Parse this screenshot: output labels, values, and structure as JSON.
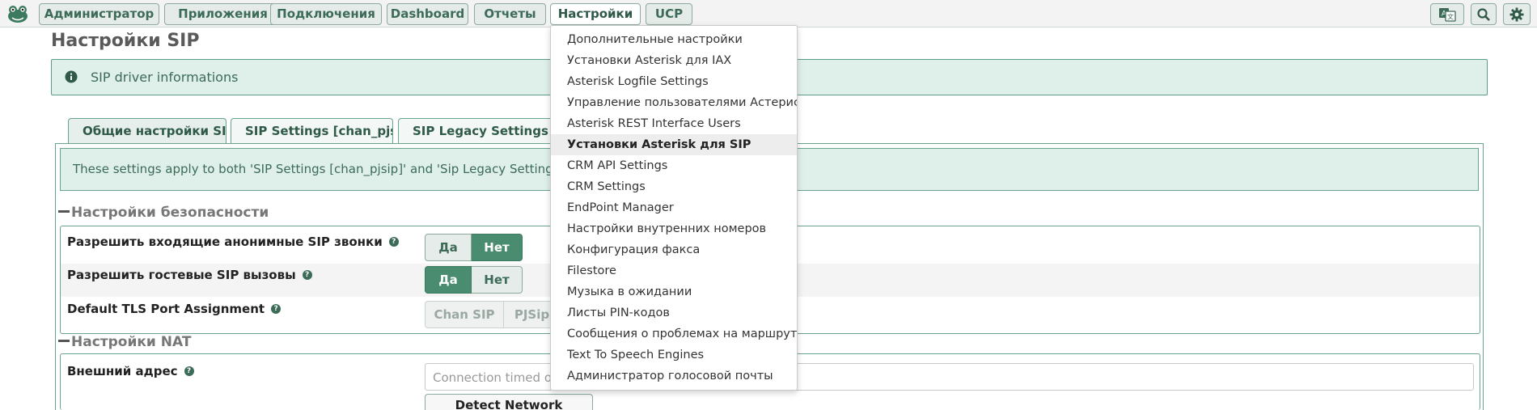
{
  "nav": {
    "items": [
      "Администратор",
      "Приложения",
      "Подключения",
      "Dashboard",
      "Отчеты",
      "Настройки",
      "UCP"
    ]
  },
  "icons": {
    "logo": "frog-logo-icon",
    "translate": "translate-icon",
    "search": "search-icon",
    "settings": "gear-icon",
    "info": "info-icon",
    "help": "question-icon"
  },
  "colors": {
    "accent": "#4a8c6f",
    "alert_bg": "#dfefea",
    "border": "#6aa38b"
  },
  "page": {
    "title": "Настройки SIP"
  },
  "alert": {
    "text": "SIP driver informations"
  },
  "tabs": [
    "Общие настройки SIP",
    "SIP Settings [chan_pjsip]",
    "SIP Legacy Settings [chan_sip]"
  ],
  "note": {
    "text": "These settings apply to both 'SIP Settings [chan_pjsip]' and 'Sip Legacy Settings [chan_sip]'."
  },
  "security": {
    "title": "Настройки безопасности",
    "rows": [
      {
        "label": "Разрешить входящие анонимные SIP звонки",
        "options": [
          "Да",
          "Нет"
        ],
        "selected": "Нет"
      },
      {
        "label": "Разрешить гостевые SIP вызовы",
        "options": [
          "Да",
          "Нет"
        ],
        "selected": "Да"
      },
      {
        "label": "Default TLS Port Assignment",
        "options": [
          "Chan SIP",
          "PJSip"
        ],
        "selected": ""
      }
    ]
  },
  "nat": {
    "title": "Настройки NAT",
    "external_label": "Внешний адрес",
    "external_value": "Connection timed out",
    "detect_button": "Detect Network Settings"
  },
  "dropdown": {
    "items": [
      "Дополнительные настройки",
      "Установки Asterisk для IAX",
      "Asterisk Logfile Settings",
      "Управление пользователями Астериск",
      "Asterisk REST Interface Users",
      "Установки Asterisk для SIP",
      "CRM API Settings",
      "CRM Settings",
      "EndPoint Manager",
      "Настройки внутренних номеров",
      "Конфигурация факса",
      "Filestore",
      "Музыка в ожидании",
      "Листы PIN-кодов",
      "Сообщения о проблемах на маршруте",
      "Text To Speech Engines",
      "Администратор голосовой почты"
    ],
    "highlighted": "Установки Asterisk для SIP"
  }
}
